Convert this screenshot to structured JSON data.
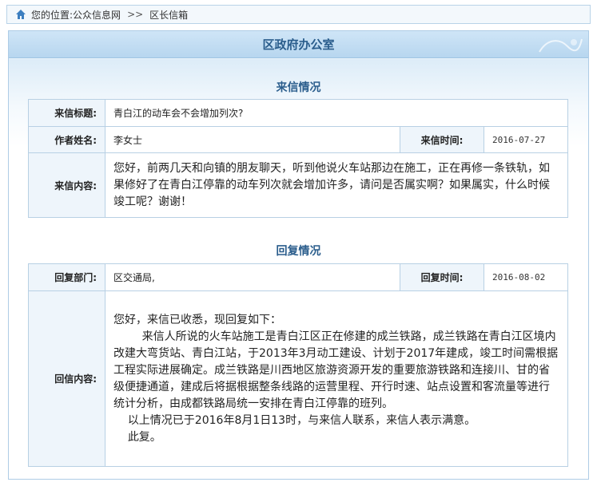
{
  "breadcrumb": {
    "prefix": "您的位置:",
    "site": "公众信息网",
    "separator": ">>",
    "current": "区长信箱"
  },
  "panel": {
    "title": "区政府办公室"
  },
  "letter": {
    "section_title": "来信情况",
    "subject_label": "来信标题:",
    "subject": "青白江的动车会不会增加列次?",
    "author_label": "作者姓名:",
    "author": "李女士",
    "time_label": "来信时间:",
    "time": "2016-07-27",
    "content_label": "来信内容:",
    "content": "您好，前两几天和向镇的朋友聊天，听到他说火车站那边在施工，正在再修一条铁轨，如果修好了在青白江停靠的动车列次就会增加许多，请问是否属实啊？如果属实，什么时候竣工呢？谢谢！"
  },
  "reply": {
    "section_title": "回复情况",
    "dept_label": "回复部门:",
    "dept": "区交通局,",
    "time_label": "回复时间:",
    "time": "2016-08-02",
    "content_label": "回信内容:",
    "content": "您好，来信已收悉，现回复如下：\n        来信人所说的火车站施工是青白江区正在修建的成兰铁路，成兰铁路在青白江区境内改建大弯货站、青白江站，于2013年3月动工建设、计划于2017年建成，竣工时间需根据工程实际进展确定。成兰铁路是川西地区旅游资源开发的重要旅游铁路和连接川、甘的省级便捷通道，建成后将据根据整条线路的运营里程、开行时速、站点设置和客流量等进行统计分析，由成都铁路局统一安排在青白江停靠的班列。\n    以上情况已于2016年8月1日13时，与来信人联系，来信人表示满意。\n    此复。"
  },
  "colors": {
    "accent": "#2a5d8c",
    "border": "#b8d0e4",
    "label_bg": "#eef5fb"
  }
}
